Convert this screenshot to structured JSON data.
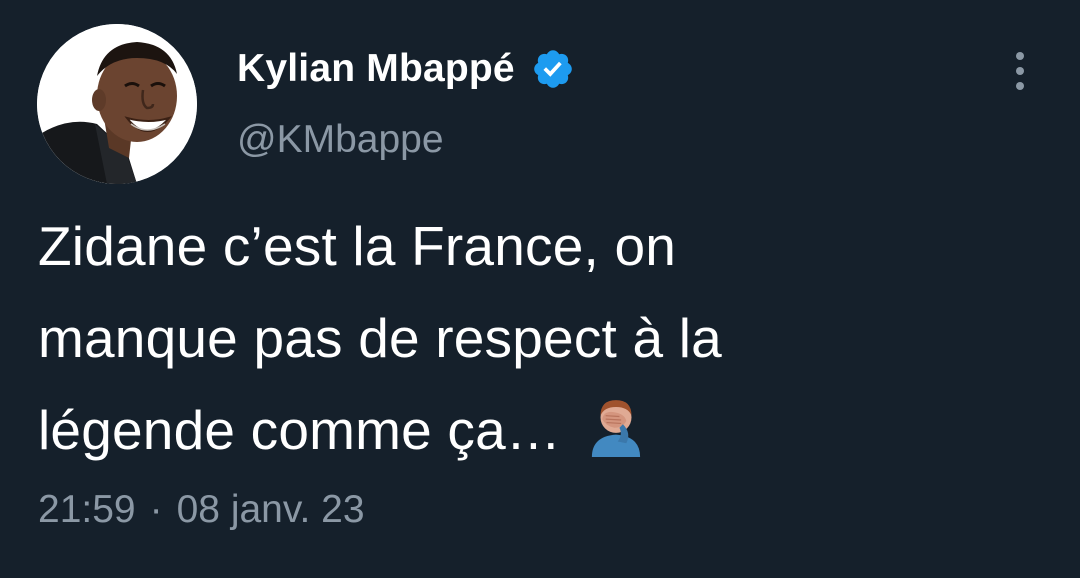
{
  "author": {
    "display_name": "Kylian Mbappé",
    "handle": "@KMbappe",
    "verified": true,
    "verified_icon": "verified-badge-icon"
  },
  "tweet": {
    "text": "Zidane c’est la France, on\nmanque pas de respect à la\nlégende comme ça…",
    "emoji": "man-facepalming",
    "time": "21:59",
    "separator": "·",
    "date": "08 janv. 23"
  },
  "colors": {
    "background": "#15202b",
    "text": "#ffffff",
    "secondary_text": "#8b98a5",
    "verified_blue": "#1d9bf0"
  },
  "icons": {
    "more_menu": "more-vertical-icon"
  }
}
